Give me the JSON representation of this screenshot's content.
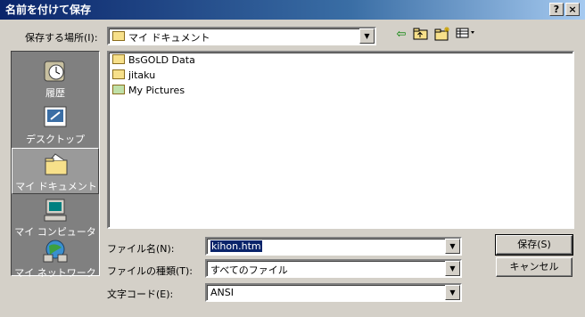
{
  "window": {
    "title": "名前を付けて保存",
    "help_glyph": "?",
    "close_glyph": "×"
  },
  "toolbar": {
    "save_in_label": "保存する場所(I):",
    "location_value": "マイ ドキュメント",
    "back_icon": "back-arrow-icon",
    "up_icon": "up-folder-icon",
    "new_folder_icon": "new-folder-icon",
    "view_menu_icon": "view-menu-icon"
  },
  "places": [
    {
      "label": "履歴",
      "icon": "history-icon",
      "selected": false
    },
    {
      "label": "デスクトップ",
      "icon": "desktop-icon",
      "selected": false
    },
    {
      "label": "マイ ドキュメント",
      "icon": "my-documents-icon",
      "selected": true
    },
    {
      "label": "マイ コンピュータ",
      "icon": "my-computer-icon",
      "selected": false
    },
    {
      "label": "マイ ネットワーク",
      "icon": "my-network-icon",
      "selected": false
    }
  ],
  "files": [
    {
      "name": "BsGOLD Data",
      "icon": "folder-icon"
    },
    {
      "name": "jitaku",
      "icon": "folder-icon"
    },
    {
      "name": "My Pictures",
      "icon": "pictures-folder-icon"
    }
  ],
  "form": {
    "filename_label": "ファイル名(N):",
    "filename_value": "kihon.htm",
    "filetype_label": "ファイルの種類(T):",
    "filetype_value": "すべてのファイル",
    "encoding_label": "文字コード(E):",
    "encoding_value": "ANSI"
  },
  "buttons": {
    "save": "保存(S)",
    "cancel": "キャンセル"
  },
  "colors": {
    "title_start": "#0a246a",
    "title_end": "#a6caf0",
    "face": "#d4d0c8",
    "selection": "#0a246a"
  }
}
